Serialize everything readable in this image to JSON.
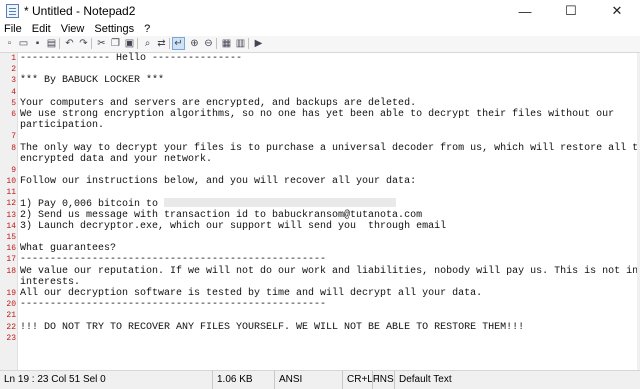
{
  "window": {
    "title": "* Untitled - Notepad2",
    "minimize": "—",
    "maximize": "☐",
    "close": "✕"
  },
  "menu": [
    "File",
    "Edit",
    "View",
    "Settings",
    "?"
  ],
  "toolbar_icons": [
    "new-icon",
    "open-icon",
    "save-icon",
    "save-as-icon",
    "undo-icon",
    "redo-icon",
    "cut-icon",
    "copy-icon",
    "paste-icon",
    "find-icon",
    "replace-icon",
    "word-wrap-icon",
    "zoom-in-icon",
    "zoom-out-icon",
    "view-scheme-icon",
    "customize-schemes-icon",
    "run-icon"
  ],
  "editor": {
    "lines": [
      "--------------- Hello ---------------",
      "",
      "*** By BABUCK LOCKER ***",
      "",
      "Your computers and servers are encrypted, and backups are deleted.",
      "We use strong encryption algorithms, so no one has yet been able to decrypt their files without our",
      "participation.",
      "",
      "The only way to decrypt your files is to purchase a universal decoder from us, which will restore all the",
      "encrypted data and your network.",
      "",
      "Follow our instructions below, and you will recover all your data:",
      "",
      "1) Pay 0,006 bitcoin to ",
      "2) Send us message with transaction id to babuckransom@tutanota.com",
      "3) Launch decryptor.exe, which our support will send you  through email",
      "",
      "What guarantees?",
      "---------------------------------------------------",
      "We value our reputation. If we will not do our work and liabilities, nobody will pay us. This is not in our",
      "interests.",
      "All our decryption software is tested by time and will decrypt all your data.",
      "---------------------------------------------------",
      "",
      "!!! DO NOT TRY TO RECOVER ANY FILES YOURSELF. WE WILL NOT BE ABLE TO RESTORE THEM!!!",
      ""
    ],
    "line_numbers": [
      "1",
      "2",
      "3",
      "4",
      "5",
      "6",
      "",
      "7",
      "8",
      "",
      "9",
      "10",
      "11",
      "12",
      "13",
      "14",
      "15",
      "16",
      "17",
      "18",
      "",
      "19",
      "20",
      "21",
      "22",
      "23"
    ]
  },
  "status": {
    "position": "Ln 19 : 23  Col 51  Sel 0",
    "size": "1.06 KB",
    "encoding": "ANSI",
    "line_endings": "CR+LF",
    "insert_mode": "INS",
    "scheme": "Default Text"
  }
}
